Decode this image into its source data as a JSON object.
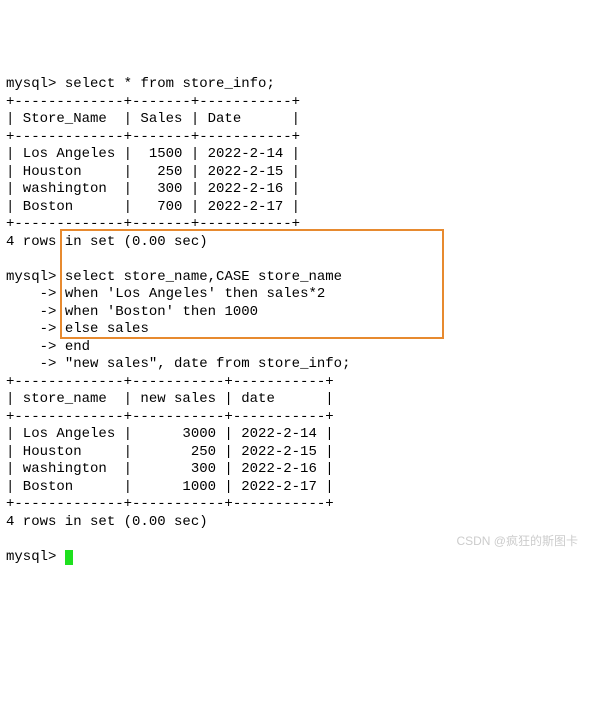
{
  "query1": {
    "prompt": "mysql>",
    "sql": "select * from store_info;",
    "border": "+-------------+-------+-----------+",
    "header": "| Store_Name  | Sales | Date      |",
    "rows": [
      "| Los Angeles |  1500 | 2022-2-14 |",
      "| Houston     |   250 | 2022-2-15 |",
      "| washington  |   300 | 2022-2-16 |",
      "| Boston      |   700 | 2022-2-17 |"
    ],
    "footer": "4 rows in set (0.00 sec)"
  },
  "query2": {
    "prompt": "mysql>",
    "cont": "    ->",
    "lines": [
      "select store_name,CASE store_name",
      "when 'Los Angeles' then sales*2",
      "when 'Boston' then 1000",
      "else sales",
      "end",
      "\"new sales\", date from store_info;"
    ],
    "border": "+-------------+-----------+-----------+",
    "header": "| store_name  | new sales | date      |",
    "rows": [
      "| Los Angeles |      3000 | 2022-2-14 |",
      "| Houston     |       250 | 2022-2-15 |",
      "| washington  |       300 | 2022-2-16 |",
      "| Boston      |      1000 | 2022-2-17 |"
    ],
    "footer": "4 rows in set (0.00 sec)"
  },
  "final_prompt": "mysql>",
  "watermark": "CSDN @疯狂的斯图卡",
  "chart_data": [
    {
      "type": "table",
      "title": "store_info",
      "columns": [
        "Store_Name",
        "Sales",
        "Date"
      ],
      "rows": [
        [
          "Los Angeles",
          1500,
          "2022-2-14"
        ],
        [
          "Houston",
          250,
          "2022-2-15"
        ],
        [
          "washington",
          300,
          "2022-2-16"
        ],
        [
          "Boston",
          700,
          "2022-2-17"
        ]
      ]
    },
    {
      "type": "table",
      "title": "case result",
      "columns": [
        "store_name",
        "new sales",
        "date"
      ],
      "rows": [
        [
          "Los Angeles",
          3000,
          "2022-2-14"
        ],
        [
          "Houston",
          250,
          "2022-2-15"
        ],
        [
          "washington",
          300,
          "2022-2-16"
        ],
        [
          "Boston",
          1000,
          "2022-2-17"
        ]
      ]
    }
  ]
}
